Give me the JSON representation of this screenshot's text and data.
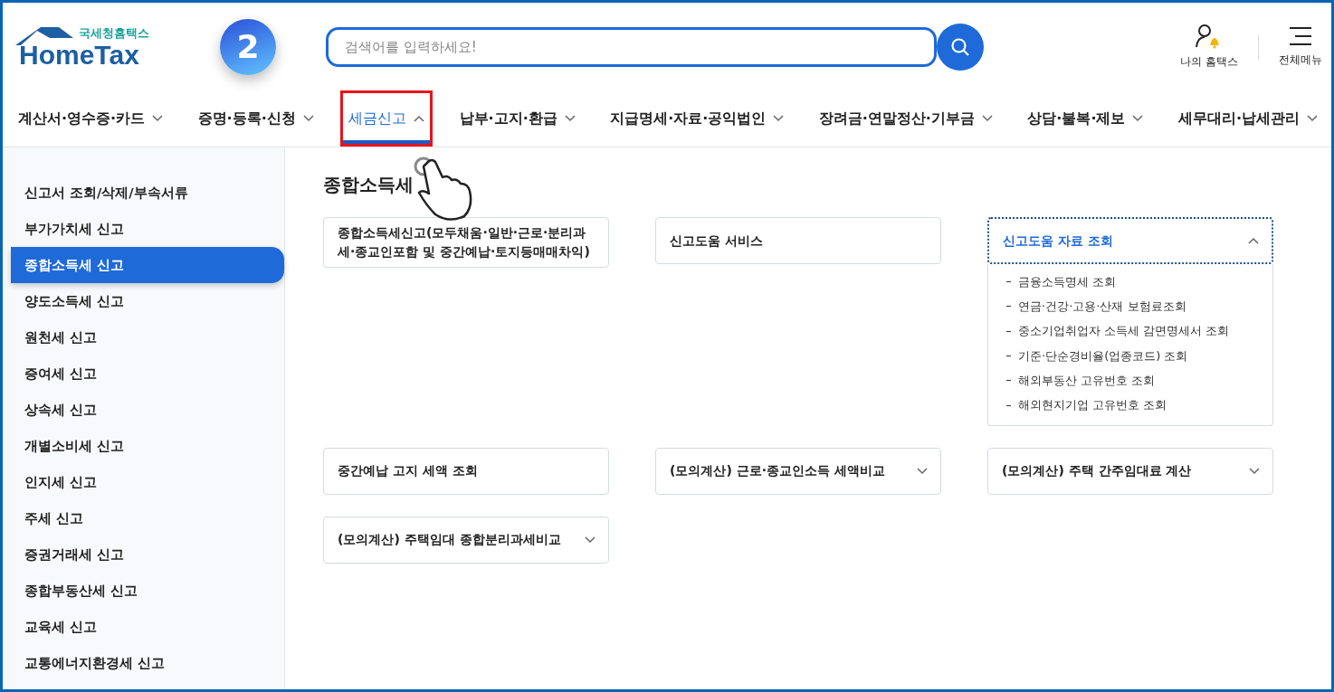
{
  "header": {
    "logo": {
      "caption": "국세청홈택스",
      "wordmark": "HomeTax"
    },
    "step_badge": "2",
    "search": {
      "placeholder": "검색어를 입력하세요!"
    },
    "actions": [
      {
        "kind": "user",
        "label": "나의 홈택스"
      },
      {
        "kind": "menu",
        "label": "전체메뉴"
      }
    ]
  },
  "nav": [
    {
      "label": "계산서·영수증·카드",
      "selected": false
    },
    {
      "label": "증명·등록·신청",
      "selected": false
    },
    {
      "label": "세금신고",
      "selected": true
    },
    {
      "label": "납부·고지·환급",
      "selected": false
    },
    {
      "label": "지급명세·자료·공익법인",
      "selected": false
    },
    {
      "label": "장려금·연말정산·기부금",
      "selected": false
    },
    {
      "label": "상담·불복·제보",
      "selected": false
    },
    {
      "label": "세무대리·납세관리",
      "selected": false
    }
  ],
  "sidebar": {
    "items": [
      {
        "label": "신고서 조회/삭제/부속서류",
        "selected": false
      },
      {
        "label": "부가가치세 신고",
        "selected": false
      },
      {
        "label": "종합소득세 신고",
        "selected": true
      },
      {
        "label": "양도소득세 신고",
        "selected": false
      },
      {
        "label": "원천세 신고",
        "selected": false
      },
      {
        "label": "증여세 신고",
        "selected": false
      },
      {
        "label": "상속세 신고",
        "selected": false
      },
      {
        "label": "개별소비세 신고",
        "selected": false
      },
      {
        "label": "인지세 신고",
        "selected": false
      },
      {
        "label": "주세 신고",
        "selected": false
      },
      {
        "label": "증권거래세 신고",
        "selected": false
      },
      {
        "label": "종합부동산세 신고",
        "selected": false
      },
      {
        "label": "교육세 신고",
        "selected": false
      },
      {
        "label": "교통에너지환경세 신고",
        "selected": false
      }
    ]
  },
  "content": {
    "title": "종합소득세",
    "cards": [
      {
        "kind": "link",
        "label": "종합소득세신고(모두채움·일반·근로·분리과세·종교인포함 및 중간예납·토지등매매차익)"
      },
      {
        "kind": "link",
        "label": "신고도움 서비스"
      },
      {
        "kind": "dropdown",
        "label": "신고도움 자료 조회",
        "expanded": true,
        "items": [
          "금융소득명세 조회",
          "연금·건강·고용·산재 보험료조회",
          "중소기업취업자 소득세 감면명세서 조회",
          "기준·단순경비율(업종코드) 조회",
          "해외부동산 고유번호 조회",
          "해외현지기업 고유번호 조회"
        ]
      },
      {
        "kind": "link",
        "label": "중간예납 고지 세액 조회"
      },
      {
        "kind": "dropdown",
        "label": "(모의계산) 근로·종교인소득 세액비교",
        "expanded": false
      },
      {
        "kind": "dropdown",
        "label": "(모의계산) 주택 간주임대료 계산",
        "expanded": false
      },
      {
        "kind": "dropdown",
        "label": "(모의계산) 주택임대 종합분리과세비교",
        "expanded": false
      }
    ]
  }
}
